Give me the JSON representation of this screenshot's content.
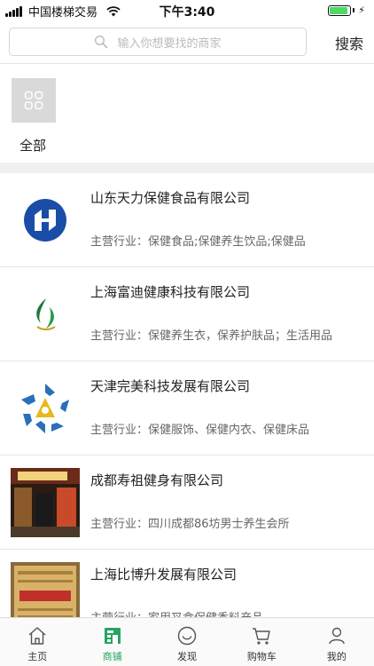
{
  "status_bar": {
    "carrier": "中国楼梯交易",
    "time": "下午3:40",
    "battery_percent": 90
  },
  "search": {
    "placeholder": "输入你想要找的商家",
    "button_label": "搜索"
  },
  "category": {
    "label": "全部",
    "icon": "grid-icon"
  },
  "shops": [
    {
      "name": "山东天力保健食品有限公司",
      "desc": "主营行业：保健食品;保健养生饮品;保健品",
      "logo": "tianli-logo"
    },
    {
      "name": "上海富迪健康科技有限公司",
      "desc": "主营行业：保健养生衣，保养护肤品；生活用品",
      "logo": "fudi-logo"
    },
    {
      "name": "天津完美科技发展有限公司",
      "desc": "主营行业：保健服饰、保健内衣、保健床品",
      "logo": "wanmei-logo"
    },
    {
      "name": "成都寿祖健身有限公司",
      "desc": "主营行业：四川成都86坊男士养生会所",
      "logo": "shouzu-photo"
    },
    {
      "name": "上海比博升发展有限公司",
      "desc": "主营行业：家用叉盒保健香料产品",
      "logo": "bibosheng-photo"
    }
  ],
  "tab_bar": {
    "tabs": [
      {
        "label": "主页",
        "icon": "home-icon",
        "active": false
      },
      {
        "label": "商铺",
        "icon": "shop-icon",
        "active": true
      },
      {
        "label": "发现",
        "icon": "discover-icon",
        "active": false
      },
      {
        "label": "购物车",
        "icon": "cart-icon",
        "active": false
      },
      {
        "label": "我的",
        "icon": "user-icon",
        "active": false
      }
    ]
  },
  "colors": {
    "accent": "#27a360",
    "battery": "#4cd964",
    "divider": "#f0f0f0"
  }
}
